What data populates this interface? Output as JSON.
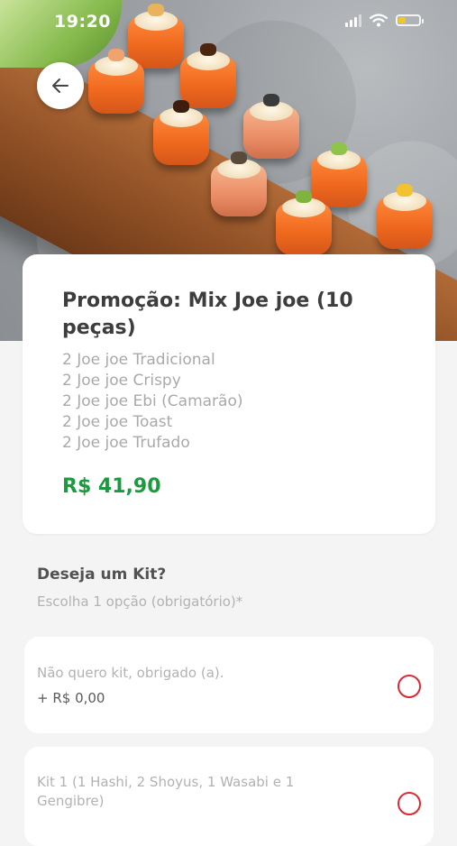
{
  "status_bar": {
    "time": "19:20"
  },
  "product": {
    "title": "Promoção: Mix Joe joe (10 peças)",
    "items": [
      "2 Joe joe Tradicional",
      "2 Joe joe Crispy",
      "2 Joe joe Ebi (Camarão)",
      "2 Joe joe Toast",
      "2 Joe joe Trufado"
    ],
    "price": "R$ 41,90"
  },
  "kit_section": {
    "title": "Deseja um Kit?",
    "subtitle": "Escolha 1 opção (obrigatório)*",
    "options": [
      {
        "label": "Não quero kit, obrigado (a).",
        "price": "+ R$ 0,00"
      },
      {
        "label": "Kit 1 (1 Hashi, 2 Shoyus, 1 Wasabi e 1 Gengibre)"
      }
    ]
  },
  "icons": {
    "back": "arrow-left-icon",
    "radio": "radio-unchecked-icon"
  },
  "colors": {
    "accent_red": "#d92b35",
    "price_green": "#1b9a3f",
    "battery": "#f3c623"
  },
  "battery_level": 0.35
}
